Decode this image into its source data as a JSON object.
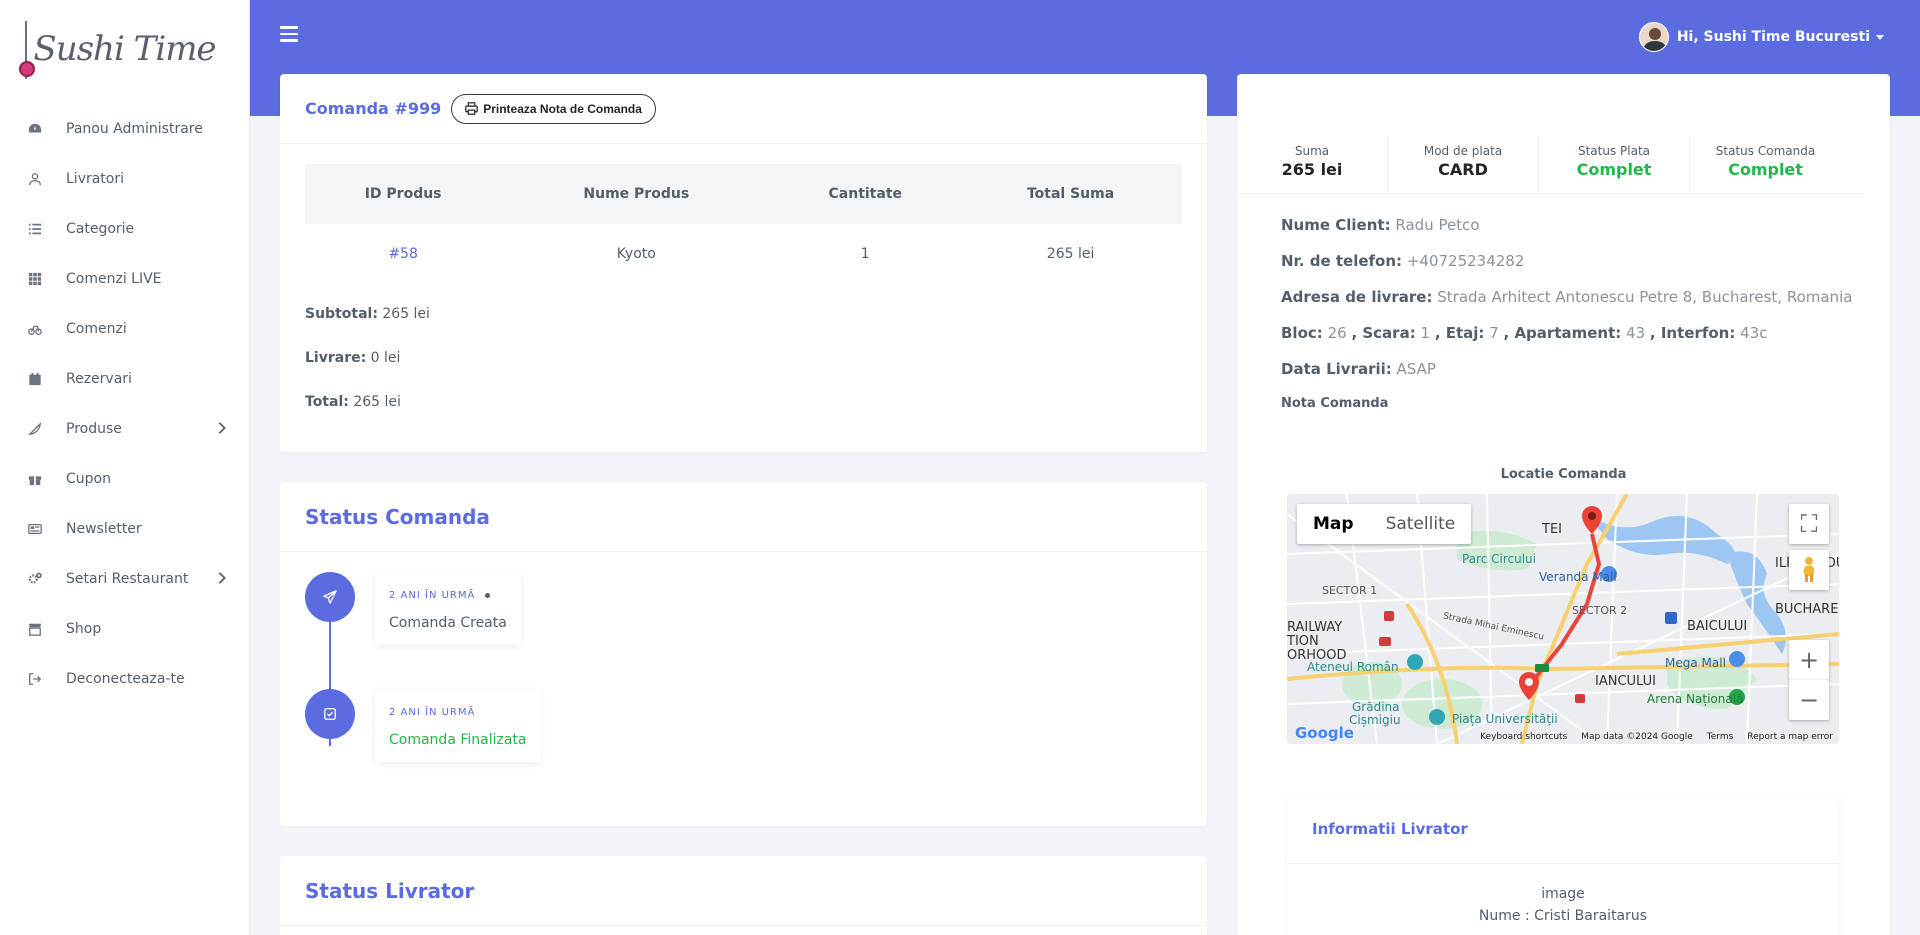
{
  "brand": {
    "logo_text": "Sushi Time"
  },
  "sidebar": {
    "items": [
      {
        "label": "Panou Administrare",
        "icon": "dashboard-icon"
      },
      {
        "label": "Livratori",
        "icon": "user-icon"
      },
      {
        "label": "Categorie",
        "icon": "list-icon"
      },
      {
        "label": "Comenzi LIVE",
        "icon": "grid-icon"
      },
      {
        "label": "Comenzi",
        "icon": "bike-icon"
      },
      {
        "label": "Rezervari",
        "icon": "calendar-icon"
      },
      {
        "label": "Produse",
        "icon": "pizza-icon",
        "has_children": true
      },
      {
        "label": "Cupon",
        "icon": "gift-icon"
      },
      {
        "label": "Newsletter",
        "icon": "newsletter-icon"
      },
      {
        "label": "Setari Restaurant",
        "icon": "gears-icon",
        "has_children": true
      },
      {
        "label": "Shop",
        "icon": "shop-icon"
      },
      {
        "label": "Deconecteaza-te",
        "icon": "logout-icon"
      }
    ]
  },
  "header": {
    "greeting": "Hi, Sushi Time Bucuresti"
  },
  "order": {
    "title": "Comanda #999",
    "print_label": "Printeaza Nota de Comanda",
    "columns": [
      "ID Produs",
      "Nume Produs",
      "Cantitate",
      "Total Suma"
    ],
    "rows": [
      {
        "id": "#58",
        "name": "Kyoto",
        "qty": "1",
        "total": "265 lei"
      }
    ],
    "subtotal_label": "Subtotal:",
    "subtotal_value": "265 lei",
    "delivery_label": "Livrare:",
    "delivery_value": "0 lei",
    "total_label": "Total:",
    "total_value": "265 lei"
  },
  "status": {
    "title": "Status Comanda",
    "events": [
      {
        "time": "2 ANI ÎN URMĂ",
        "text": "Comanda Creata",
        "icon": "paper-plane-icon"
      },
      {
        "time": "2 ANI ÎN URMĂ",
        "text": "Comanda Finalizata",
        "icon": "check-square-icon"
      }
    ]
  },
  "courier_status": {
    "title": "Status Livrator"
  },
  "summary": {
    "suma_label": "Suma",
    "suma_value": "265 lei",
    "payment_label": "Mod de plata",
    "payment_value": "CARD",
    "pay_status_label": "Status Plata",
    "pay_status_value": "Complet",
    "order_status_label": "Status Comanda",
    "order_status_value": "Complet",
    "success_color": "#21b74a"
  },
  "client": {
    "name_label": "Nume Client:",
    "name_value": "Radu Petco",
    "phone_label": "Nr. de telefon:",
    "phone_value": "+40725234282",
    "address_label": "Adresa de livrare:",
    "address_value": "Strada Arhitect Antonescu Petre 8, Bucharest, Romania",
    "bloc_label": "Bloc:",
    "bloc_value": "26",
    "scara_label": ", Scara:",
    "scara_value": "1",
    "etaj_label": ", Etaj:",
    "etaj_value": "7",
    "apartament_label": ", Apartament:",
    "apartament_value": "43",
    "interfon_label": ", Interfon:",
    "interfon_value": "43c",
    "date_label": "Data Livrarii:",
    "date_value": "ASAP",
    "note_label": "Nota Comanda"
  },
  "map": {
    "title": "Locatie Comanda",
    "tab_map": "Map",
    "tab_satellite": "Satellite",
    "labels": {
      "tei": "TEI",
      "parc": "Parc Circului",
      "veranda": "Veranda Mall",
      "ilfov": "ILFOV COU",
      "sector1": "SECTOR 1",
      "sector2": "SECTOR 2",
      "bucharest": "BUCHARE",
      "baiciului": "BAICULUI",
      "railway": "RAILWAY",
      "tion": "TION",
      "orhood": "ORHOOD",
      "mihai": "Strada Mihai Eminescu",
      "ateneul": "Ateneul Român",
      "mega": "Mega Mall",
      "iancului": "IANCULUI",
      "gradina1": "Grădina",
      "gradina2": "Cișmigiu",
      "piata": "Piața Universității",
      "arena": "Arena Națională"
    },
    "footer": {
      "shortcuts": "Keyboard shortcuts",
      "data": "Map data ©2024 Google",
      "terms": "Terms",
      "report": "Report a map error"
    },
    "google": "Google"
  },
  "driver": {
    "title": "Informatii Livrator",
    "image_alt": "image",
    "name_label": "Nume : Cristi Baraitarus"
  },
  "colors": {
    "accent": "#5b6be0",
    "success": "#21b74a"
  }
}
